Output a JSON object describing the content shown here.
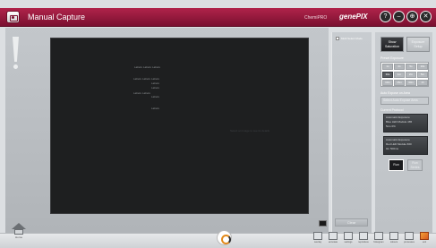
{
  "window": {
    "title": "Manual Capture",
    "brand_small": "ChemiPRO",
    "brand_large": "genePIX",
    "controls": [
      "?",
      "–",
      "⊕",
      "✕"
    ]
  },
  "canvas": {
    "blot_labels": [
      "Labels",
      "Labels",
      "Labels",
      "Labels",
      "Labels",
      "Labels",
      "Labels",
      "Labels",
      "Labels",
      "Labels",
      "Labels",
      "Labels"
    ],
    "message": "Select an Image to see its details"
  },
  "middle_panel": {
    "multi_select_label": "Multi Select Mode",
    "clear_label": "Clear"
  },
  "right_panel": {
    "tabs": [
      {
        "label": "Show Saturation",
        "active": true
      },
      {
        "label": "Exposure Setup",
        "active": false
      }
    ],
    "preset_title": "Preset Exposure",
    "presets": [
      "1s",
      "2s",
      "5s",
      "10s",
      "30s",
      "1m",
      "2m",
      "5m",
      "10m",
      "15m",
      "30m",
      "1h"
    ],
    "active_preset_index": 4,
    "auto_expose_title": "Auto Expose on Area",
    "auto_expose_label": "Select Auto Expose Area",
    "protocol_title": "Current Protocol",
    "protocols": [
      [
        "Automatic Exposure",
        "Blue LED Module 465",
        "5ms 0%"
      ],
      [
        "Automatic Exposure",
        "Red LED Module 660",
        "0m 500ms"
      ]
    ],
    "run_active": "Run",
    "run_inactive": "Run Series"
  },
  "bottom_bar": {
    "home_label": "Home",
    "tools": [
      "overlay",
      "annotate",
      "settings",
      "reproduce",
      "histogram",
      "colours",
      "processes",
      "exit"
    ]
  },
  "colors": {
    "title_bar": "#9a1a3e",
    "canvas": "#1e1f20",
    "active_button": "#1b1c1e"
  }
}
